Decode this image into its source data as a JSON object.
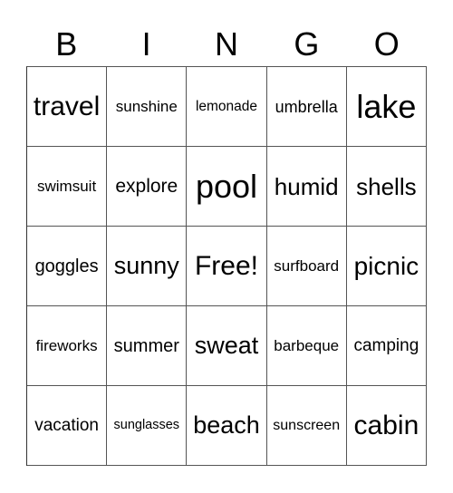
{
  "header": [
    "B",
    "I",
    "N",
    "G",
    "O"
  ],
  "cells": [
    "travel",
    "sunshine",
    "lemonade",
    "umbrella",
    "lake",
    "swimsuit",
    "explore",
    "pool",
    "humid",
    "shells",
    "goggles",
    "sunny",
    "Free!",
    "surfboard",
    "picnic",
    "fireworks",
    "summer",
    "sweat",
    "barbeque",
    "camping",
    "vacation",
    "sunglasses",
    "beach",
    "sunscreen",
    "cabin"
  ],
  "free_space_label": "Free!",
  "colors": {
    "grid_line": "#555555",
    "text": "#000000",
    "background": "#ffffff"
  }
}
